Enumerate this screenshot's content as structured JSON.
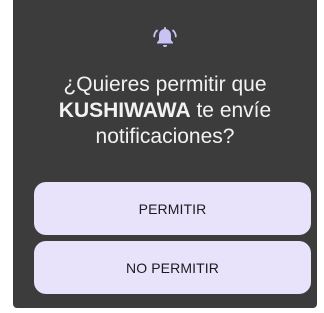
{
  "dialog": {
    "icon": "bell-ringing-icon",
    "title_prefix": "¿Quieres permitir que",
    "app_name": "KUSHIWAWA",
    "title_suffix": "te envíe notificaciones?",
    "allow_label": "PERMITIR",
    "deny_label": "NO PERMITIR"
  },
  "colors": {
    "dialog_background": "#3c3c3d",
    "button_background": "#e8e3fb",
    "icon": "#c9c2f5",
    "title_text": "#f2f2f2"
  }
}
